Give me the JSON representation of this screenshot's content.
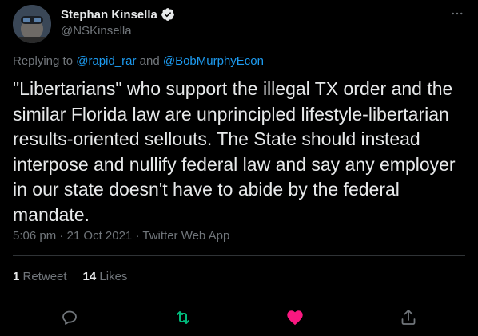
{
  "author": {
    "display_name": "Stephan Kinsella",
    "handle": "@NSKinsella",
    "verified": true
  },
  "more_icon": "more-horizontal-icon",
  "reply": {
    "prefix": "Replying to",
    "mention1": "@rapid_rar",
    "conj": "and",
    "mention2": "@BobMurphyEcon"
  },
  "tweet_text": "\"Libertarians\" who support the illegal TX order and the similar Florida law are unprincipled lifestyle-libertarian results-oriented sellouts. The State should instead interpose and nullify federal law and say any employer in our state doesn't have to abide by the federal mandate.",
  "meta": {
    "time": "5:06 pm",
    "date": "21 Oct 2021",
    "client": "Twitter Web App"
  },
  "stats": {
    "retweets_count": "1",
    "retweets_label": "Retweet",
    "likes_count": "14",
    "likes_label": "Likes"
  },
  "actions": [
    "reply-icon",
    "retweet-icon",
    "like-icon",
    "share-icon"
  ],
  "colors": {
    "background": "#000000",
    "text": "#e7e9ea",
    "secondary": "#71767b",
    "link": "#1d9bf0",
    "retweet": "#00ba7c",
    "like": "#f91880",
    "divider": "#2f3336"
  }
}
